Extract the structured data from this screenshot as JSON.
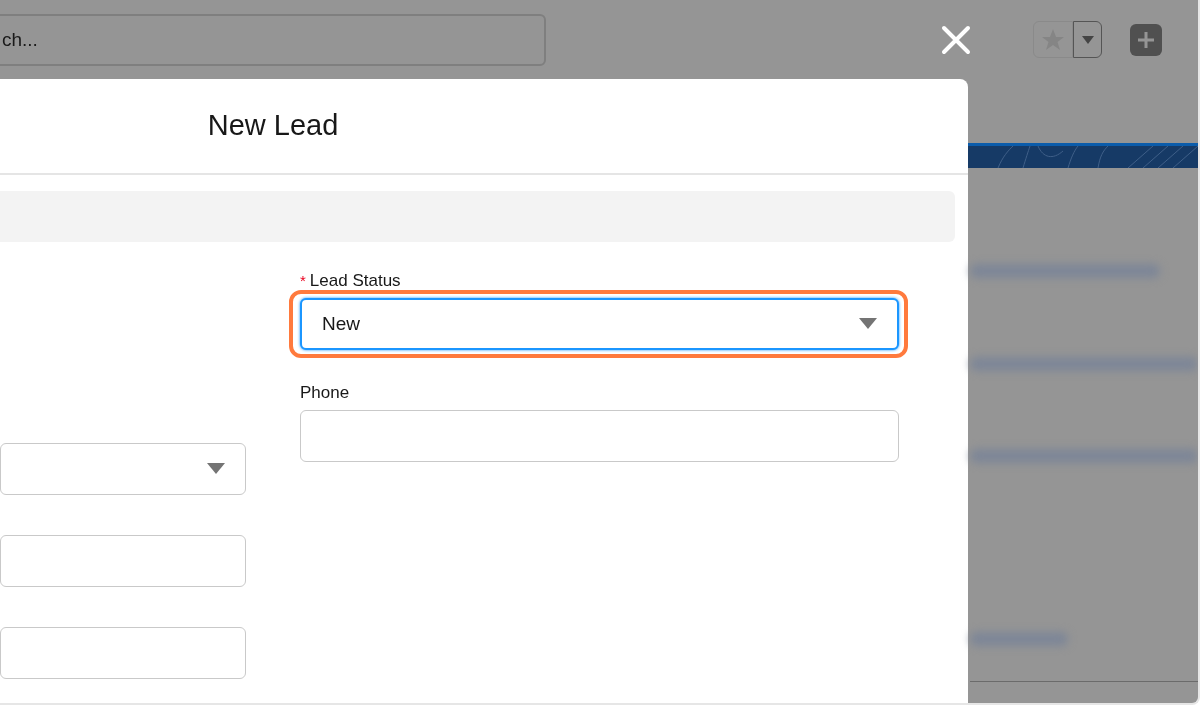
{
  "top_bar": {
    "search": {
      "placeholder": "ch..."
    }
  },
  "modal": {
    "title": "New Lead",
    "left_fields": [
      {
        "kind": "select"
      },
      {
        "kind": "input"
      },
      {
        "kind": "input"
      }
    ],
    "right_fields": [
      {
        "marker": "*",
        "label": "Lead Status",
        "kind": "select",
        "value": "New",
        "highlighted": true
      },
      {
        "label": "Phone",
        "kind": "input",
        "highlighted": false
      }
    ]
  }
}
